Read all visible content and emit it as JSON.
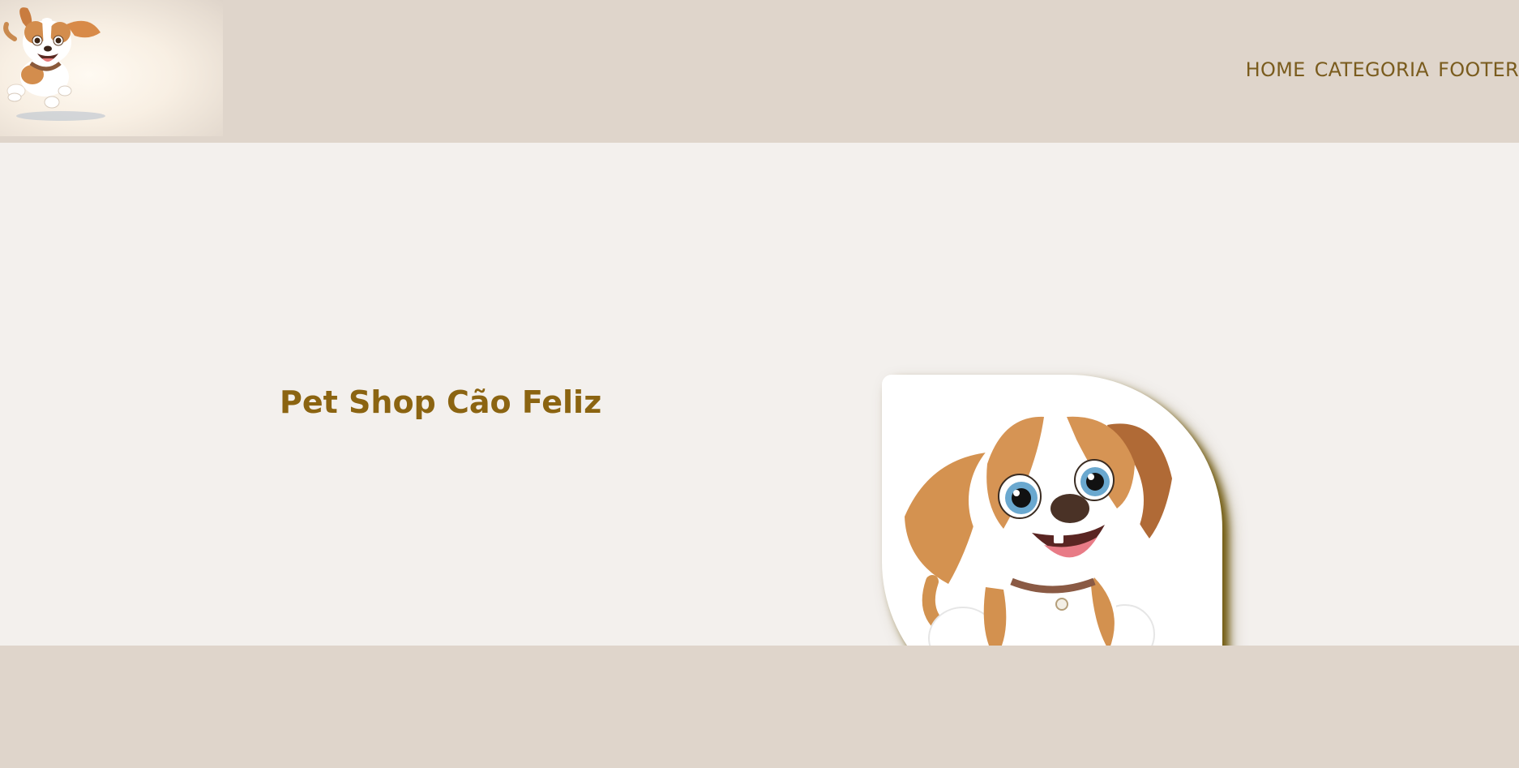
{
  "header": {
    "logo_icon": "running-puppy-icon",
    "nav": {
      "items": [
        {
          "label": "HOME"
        },
        {
          "label": "CATEGORIA"
        },
        {
          "label": "FOOTER"
        }
      ]
    }
  },
  "main": {
    "title": "Pet Shop Cão Feliz",
    "hero_icon": "sitting-puppy-icon"
  },
  "colors": {
    "header_bg": "#dfd5cb",
    "main_bg": "#f3f0ed",
    "accent_text": "#8b6411",
    "nav_text": "#7a5c1e",
    "image_shadow": "#6e5608"
  }
}
